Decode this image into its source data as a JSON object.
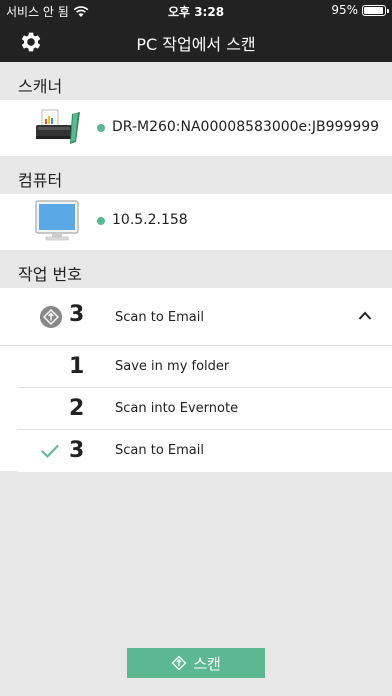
{
  "status_bar": {
    "carrier": "서비스 안 됨",
    "time": "오후 3:28",
    "battery_percent": "95%",
    "battery_level": 0.95
  },
  "nav": {
    "title": "PC 작업에서 스캔",
    "settings_icon": "gear-icon"
  },
  "scanner_section": {
    "header": "스캐너",
    "device_name": "DR-M260:NA00008583000e:JB999999",
    "status_color": "#5cb891"
  },
  "computer_section": {
    "header": "컴퓨터",
    "ip": "10.5.2.158"
  },
  "job_section": {
    "header": "작업 번호",
    "selected": {
      "number": "3",
      "label": "Scan to Email"
    },
    "items": [
      {
        "number": "1",
        "label": "Save in my folder",
        "checked": false
      },
      {
        "number": "2",
        "label": "Scan into Evernote",
        "checked": false
      },
      {
        "number": "3",
        "label": "Scan to Email",
        "checked": true
      }
    ]
  },
  "scan_button": {
    "label": "스캔"
  },
  "colors": {
    "accent": "#5cb891",
    "bar": "#222222",
    "background": "#e8e8e8"
  }
}
